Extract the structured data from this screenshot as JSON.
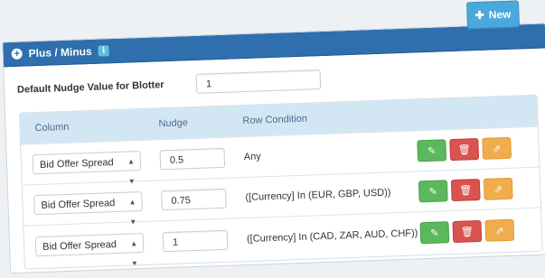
{
  "new_button": {
    "label": "New"
  },
  "panel": {
    "title": "Plus / Minus"
  },
  "default_nudge": {
    "label": "Default Nudge Value for Blotter",
    "value": "1"
  },
  "table": {
    "headers": {
      "column": "Column",
      "nudge": "Nudge",
      "row_condition": "Row Condition"
    },
    "rows": [
      {
        "column": "Bid Offer Spread",
        "nudge": "0.5",
        "condition": "Any"
      },
      {
        "column": "Bid Offer Spread",
        "nudge": "0.75",
        "condition": "([Currency] In (EUR, GBP, USD))"
      },
      {
        "column": "Bid Offer Spread",
        "nudge": "1",
        "condition": "([Currency] In (CAD, ZAR, AUD, CHF))"
      }
    ]
  },
  "icons": {
    "plus": "plus-circle-icon",
    "info": "info-icon",
    "caret": "caret-updown-icon",
    "edit": "edit-icon",
    "delete": "trash-icon",
    "share": "share-icon"
  },
  "colors": {
    "header": "#2f6fae",
    "new_button": "#4aa8dc",
    "grid_header": "#d3e6f4",
    "edit": "#5cb85c",
    "delete": "#d9534f",
    "share": "#f0ad4e"
  }
}
